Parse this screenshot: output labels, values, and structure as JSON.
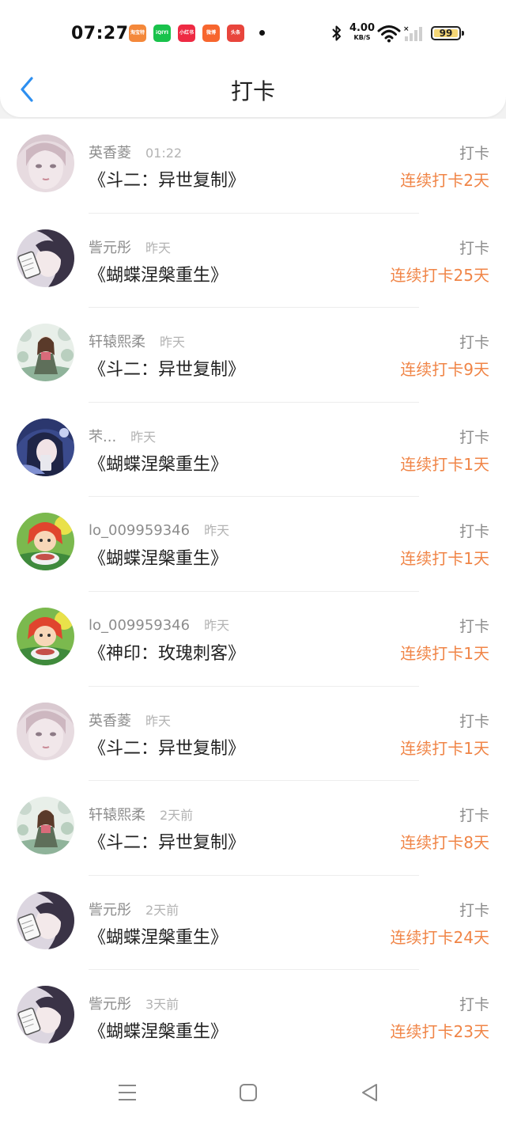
{
  "status_bar": {
    "time": "07:27",
    "net_speed": "4.00",
    "net_unit": "KB/S",
    "battery": "99",
    "apps": [
      {
        "icon": "app-icon-1",
        "color": "#f4883a",
        "text": "淘宝特价"
      },
      {
        "icon": "app-icon-iqiyi",
        "color": "#19c24b",
        "text": "iQIYI"
      },
      {
        "icon": "app-icon-xiaohongshu",
        "color": "#ee2a43",
        "text": "小红书"
      },
      {
        "icon": "app-icon-weibo",
        "color": "#f7662e",
        "text": "微博"
      },
      {
        "icon": "app-icon-toutiao",
        "color": "#e8453c",
        "text": "头条"
      }
    ]
  },
  "header": {
    "title": "打卡"
  },
  "colors": {
    "accent": "#f08547",
    "back": "#2d8ff0"
  },
  "items": [
    {
      "name": "英香菱",
      "when": "01:22",
      "book": "《斗二：异世复制》",
      "tag": "打卡",
      "streak": "连续打卡2天",
      "avatar": "pale-girl"
    },
    {
      "name": "訾元彤",
      "when": "昨天",
      "book": "《蝴蝶涅槃重生》",
      "tag": "打卡",
      "streak": "连续打卡25天",
      "avatar": "phone-girl"
    },
    {
      "name": "轩辕熙柔",
      "when": "昨天",
      "book": "《斗二：异世复制》",
      "tag": "打卡",
      "streak": "连续打卡9天",
      "avatar": "forest-girl"
    },
    {
      "name": "芣...",
      "when": "昨天",
      "book": "《蝴蝶涅槃重生》",
      "tag": "打卡",
      "streak": "连续打卡1天",
      "avatar": "blue-girl"
    },
    {
      "name": "lo_009959346",
      "when": "昨天",
      "book": "《蝴蝶涅槃重生》",
      "tag": "打卡",
      "streak": "连续打卡1天",
      "avatar": "red-anime"
    },
    {
      "name": "lo_009959346",
      "when": "昨天",
      "book": "《神印：玫瑰刺客》",
      "tag": "打卡",
      "streak": "连续打卡1天",
      "avatar": "red-anime"
    },
    {
      "name": "英香菱",
      "when": "昨天",
      "book": "《斗二：异世复制》",
      "tag": "打卡",
      "streak": "连续打卡1天",
      "avatar": "pale-girl"
    },
    {
      "name": "轩辕熙柔",
      "when": "2天前",
      "book": "《斗二：异世复制》",
      "tag": "打卡",
      "streak": "连续打卡8天",
      "avatar": "forest-girl"
    },
    {
      "name": "訾元彤",
      "when": "2天前",
      "book": "《蝴蝶涅槃重生》",
      "tag": "打卡",
      "streak": "连续打卡24天",
      "avatar": "phone-girl"
    },
    {
      "name": "訾元彤",
      "when": "3天前",
      "book": "《蝴蝶涅槃重生》",
      "tag": "打卡",
      "streak": "连续打卡23天",
      "avatar": "phone-girl"
    }
  ],
  "nav": {
    "menu": "menu-icon",
    "home": "home-icon",
    "back": "back-triangle-icon"
  }
}
